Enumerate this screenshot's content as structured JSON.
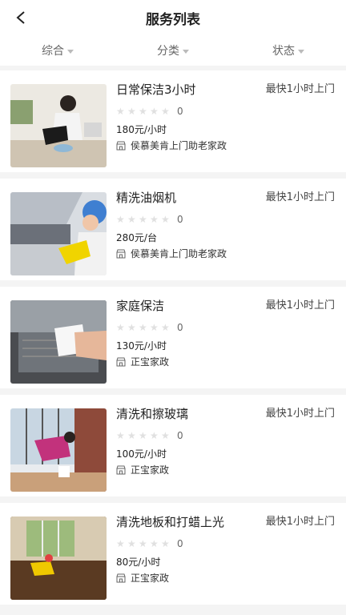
{
  "header": {
    "title": "服务列表"
  },
  "filters": [
    {
      "label": "综合"
    },
    {
      "label": "分类"
    },
    {
      "label": "状态"
    }
  ],
  "services": [
    {
      "name": "日常保洁3小时",
      "eta": "最快1小时上门",
      "rating": "0",
      "price": "180元/小时",
      "shop": "侯慕美肯上门助老家政",
      "image": "cleaner-wiping-floor"
    },
    {
      "name": "精洗油烟机",
      "eta": "最快1小时上门",
      "rating": "0",
      "price": "280元/台",
      "shop": "侯慕美肯上门助老家政",
      "image": "worker-cleaning-range-hood"
    },
    {
      "name": "家庭保洁",
      "eta": "最快1小时上门",
      "rating": "0",
      "price": "130元/小时",
      "shop": "正宝家政",
      "image": "hand-wiping-range-hood"
    },
    {
      "name": "清洗和擦玻璃",
      "eta": "最快1小时上门",
      "rating": "0",
      "price": "100元/小时",
      "shop": "正宝家政",
      "image": "cleaner-washing-window"
    },
    {
      "name": "清洗地板和打蜡上光",
      "eta": "最快1小时上门",
      "rating": "0",
      "price": "80元/小时",
      "shop": "正宝家政",
      "image": "worker-waxing-floor"
    }
  ]
}
